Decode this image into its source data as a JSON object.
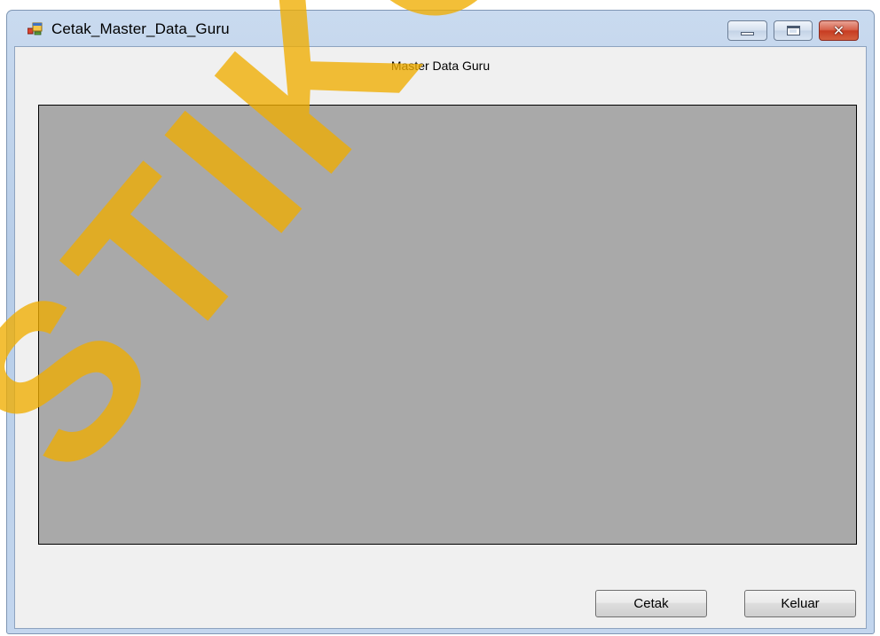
{
  "window": {
    "title": "Cetak_Master_Data_Guru",
    "app_icon": "windows-form-icon",
    "controls": {
      "minimize_icon": "minimize-icon",
      "maximize_icon": "maximize-icon",
      "close_icon": "close-icon",
      "close_glyph": "✕"
    }
  },
  "form": {
    "heading": "Master Data Guru",
    "report_viewer_background": "#a9a9a9"
  },
  "buttons": {
    "print_label": "Cetak",
    "exit_label": "Keluar"
  },
  "watermark": {
    "text": "STIKOM SURABAYA",
    "color": "#f0ad00"
  },
  "colors": {
    "client_background": "#f0f0f0",
    "titlebar": "#c9daef",
    "close_button": "#c73c22"
  }
}
